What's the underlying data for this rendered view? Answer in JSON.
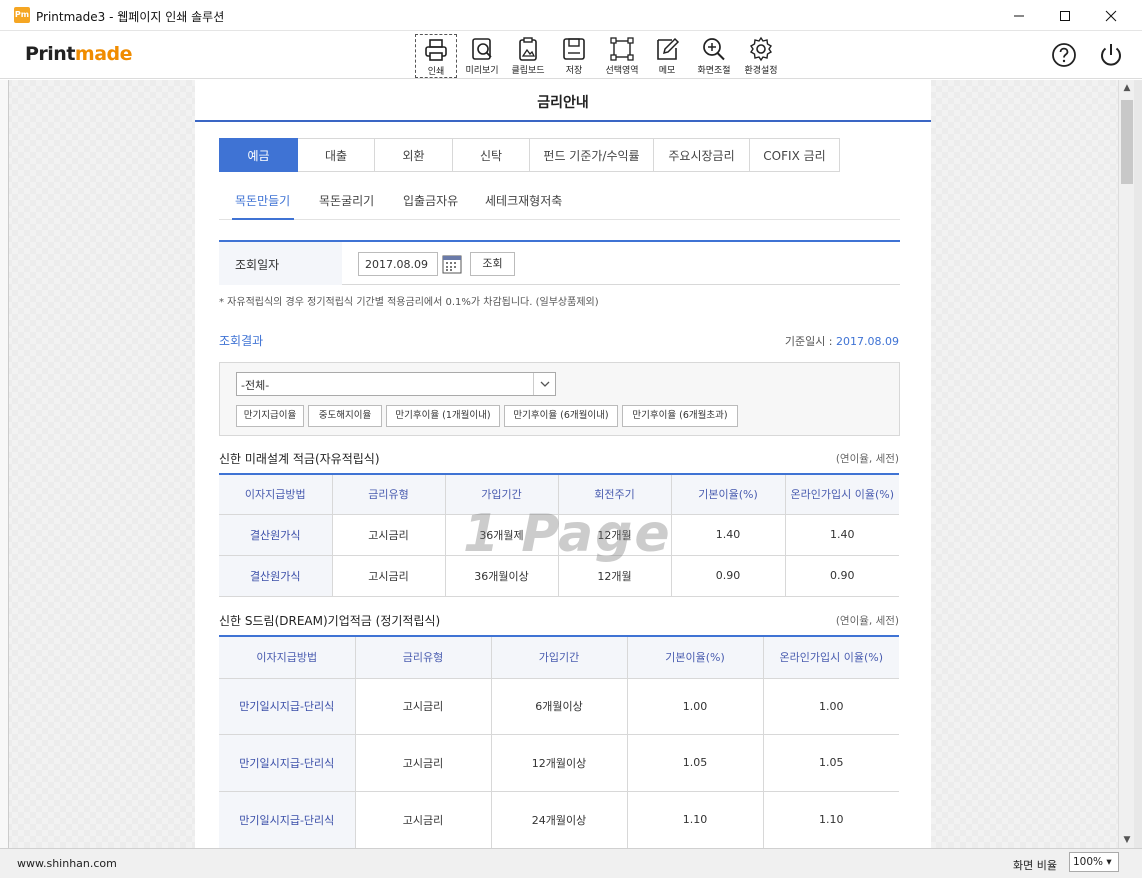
{
  "window": {
    "title": "Printmade3 - 웹페이지 인쇄 솔루션",
    "app_icon_text": "Pm"
  },
  "toolbar": {
    "logo_dark": "Print",
    "logo_orange": "made",
    "brand_color": "#f08c00",
    "tools": [
      {
        "label": "인쇄",
        "icon": "printer-icon"
      },
      {
        "label": "미리보기",
        "icon": "preview-icon"
      },
      {
        "label": "클립보드",
        "icon": "clipboard-icon"
      },
      {
        "label": "저장",
        "icon": "save-icon"
      },
      {
        "label": "선택영역",
        "icon": "selection-icon"
      },
      {
        "label": "메모",
        "icon": "memo-icon"
      },
      {
        "label": "화면조절",
        "icon": "zoom-icon"
      },
      {
        "label": "환경설정",
        "icon": "settings-icon"
      }
    ]
  },
  "page": {
    "title": "금리안내",
    "accent_color": "#3f73d4",
    "tabs": [
      "예금",
      "대출",
      "외환",
      "신탁",
      "펀드 기준가/수익률",
      "주요시장금리",
      "COFIX 금리"
    ],
    "subtabs": [
      "목돈만들기",
      "목돈굴리기",
      "입출금자유",
      "세테크재형저축"
    ],
    "search": {
      "label": "조회일자",
      "date": "2017.08.09",
      "button": "조회"
    },
    "note": "* 자유적립식의 경우 정기적립식 기간별 적용금리에서 0.1%가 차감됩니다. (일부상품제외)",
    "result_title": "조회결과",
    "base_date_label": "기준일시 :",
    "base_date_value": "2017.08.09",
    "filter": {
      "selected": "-전체-",
      "buttons": [
        "만기지급이율",
        "중도해지이율",
        "만기후이율 (1개월이내)",
        "만기후이율 (6개월이내)",
        "만기후이율 (6개월초과)"
      ]
    },
    "watermark": "1 Page",
    "section1": {
      "title": "신한 미래설계 적금(자유적립식)",
      "unit": "(연이율, 세전)",
      "headers": [
        "이자지급방법",
        "금리유형",
        "가입기간",
        "회전주기",
        "기본이율(%)",
        "온라인가입시 이율(%)"
      ],
      "rows": [
        [
          "결산원가식",
          "고시금리",
          "36개월제",
          "12개월",
          "1.40",
          "1.40"
        ],
        [
          "결산원가식",
          "고시금리",
          "36개월이상",
          "12개월",
          "0.90",
          "0.90"
        ]
      ]
    },
    "section2": {
      "title": "신한 S드림(DREAM)기업적금 (정기적립식)",
      "unit": "(연이율, 세전)",
      "headers": [
        "이자지급방법",
        "금리유형",
        "가입기간",
        "기본이율(%)",
        "온라인가입시 이율(%)"
      ],
      "rows": [
        [
          "만기일시지급-단리식",
          "고시금리",
          "6개월이상",
          "1.00",
          "1.00"
        ],
        [
          "만기일시지급-단리식",
          "고시금리",
          "12개월이상",
          "1.05",
          "1.05"
        ],
        [
          "만기일시지급-단리식",
          "고시금리",
          "24개월이상",
          "1.10",
          "1.10"
        ]
      ]
    }
  },
  "status": {
    "url": "www.shinhan.com",
    "zoom_label": "화면 비율",
    "zoom_value": "100%"
  }
}
